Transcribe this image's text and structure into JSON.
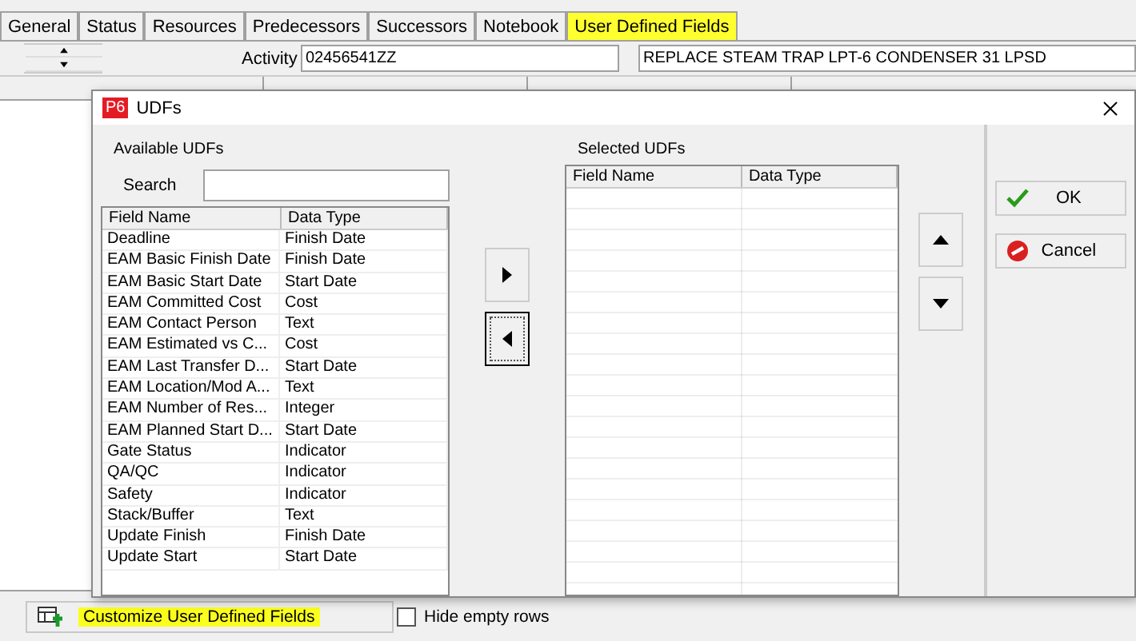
{
  "tabs": [
    {
      "label": "General",
      "selected": false
    },
    {
      "label": "Status",
      "selected": false
    },
    {
      "label": "Resources",
      "selected": false
    },
    {
      "label": "Predecessors",
      "selected": false
    },
    {
      "label": "Successors",
      "selected": false
    },
    {
      "label": "Notebook",
      "selected": false
    },
    {
      "label": "User Defined Fields",
      "selected": true
    }
  ],
  "activity": {
    "label": "Activity",
    "id": "02456541ZZ",
    "name": "REPLACE STEAM TRAP LPT-6 CONDENSER 31 LPSD"
  },
  "dialog": {
    "title": "UDFs",
    "logo": "P6",
    "available": {
      "title": "Available UDFs",
      "search_label": "Search",
      "columns": [
        "Field Name",
        "Data Type"
      ],
      "rows": [
        [
          "Deadline",
          "Finish Date"
        ],
        [
          "EAM Basic Finish Date",
          "Finish Date"
        ],
        [
          "EAM Basic Start Date",
          "Start Date"
        ],
        [
          "EAM Committed Cost",
          "Cost"
        ],
        [
          "EAM Contact Person",
          "Text"
        ],
        [
          "EAM Estimated vs C...",
          "Cost"
        ],
        [
          "EAM Last Transfer D...",
          "Start Date"
        ],
        [
          "EAM Location/Mod A...",
          "Text"
        ],
        [
          "EAM Number of Res...",
          "Integer"
        ],
        [
          "EAM Planned Start D...",
          "Start Date"
        ],
        [
          "Gate Status",
          "Indicator"
        ],
        [
          "QA/QC",
          "Indicator"
        ],
        [
          "Safety",
          "Indicator"
        ],
        [
          "Stack/Buffer",
          "Text"
        ],
        [
          "Update Finish",
          "Finish Date"
        ],
        [
          "Update Start",
          "Start Date"
        ]
      ]
    },
    "selected": {
      "title": "Selected UDFs",
      "columns": [
        "Field Name",
        "Data Type"
      ]
    },
    "ok": "OK",
    "cancel": "Cancel"
  },
  "customize_button": "Customize User Defined Fields",
  "hide_empty_rows": {
    "label": "Hide empty rows",
    "checked": false
  }
}
